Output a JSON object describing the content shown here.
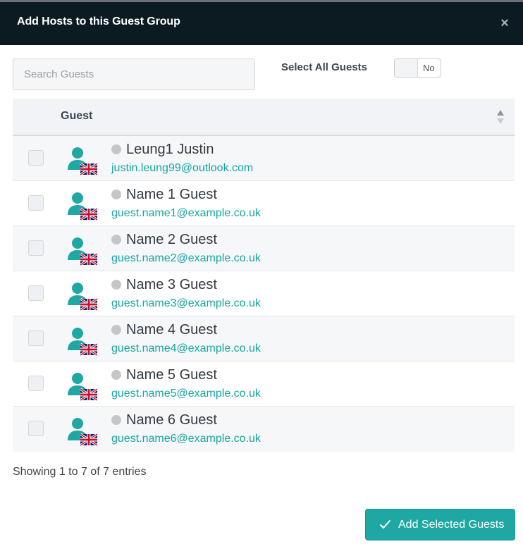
{
  "modal": {
    "title": "Add Hosts to this Guest Group",
    "close_icon": "×"
  },
  "search": {
    "placeholder": "Search Guests",
    "value": ""
  },
  "select_all": {
    "label": "Select All Guests",
    "toggle_value": "No"
  },
  "table": {
    "column_header": "Guest",
    "rows": [
      {
        "name": "Leung1 Justin",
        "email": "justin.leung99@outlook.com",
        "checked": false
      },
      {
        "name": "Name 1 Guest",
        "email": "guest.name1@example.co.uk",
        "checked": false
      },
      {
        "name": "Name 2 Guest",
        "email": "guest.name2@example.co.uk",
        "checked": false
      },
      {
        "name": "Name 3 Guest",
        "email": "guest.name3@example.co.uk",
        "checked": false
      },
      {
        "name": "Name 4 Guest",
        "email": "guest.name4@example.co.uk",
        "checked": false
      },
      {
        "name": "Name 5 Guest",
        "email": "guest.name5@example.co.uk",
        "checked": false
      },
      {
        "name": "Name 6 Guest",
        "email": "guest.name6@example.co.uk",
        "checked": false
      }
    ]
  },
  "info": "Showing 1 to 7 of 7 entries",
  "add_button": {
    "label": "Add Selected Guests"
  },
  "colors": {
    "accent": "#1fa8a3",
    "header_bg": "#0c1a22",
    "status_offline": "#c4c7ca"
  }
}
